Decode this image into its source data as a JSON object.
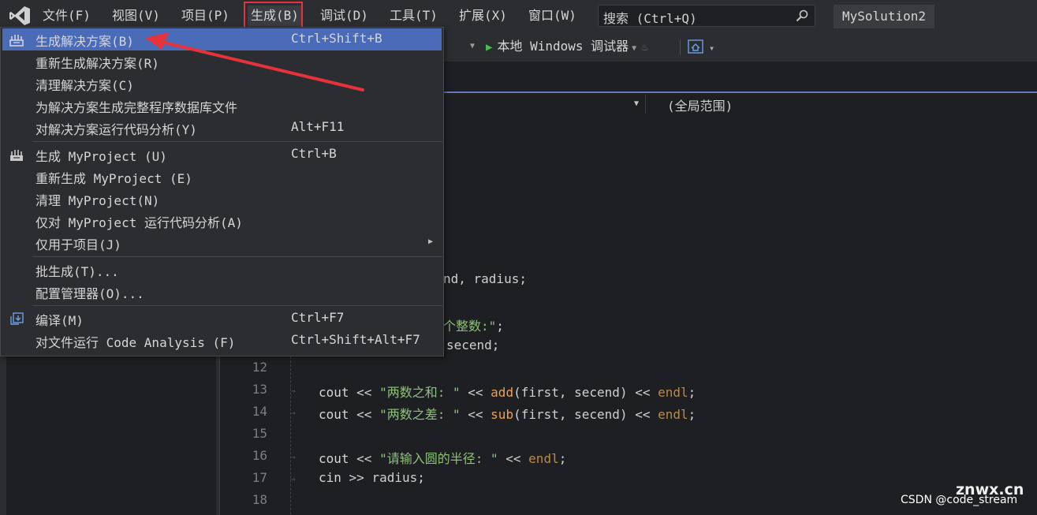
{
  "menubar": {
    "items": [
      {
        "label": "文件(F)"
      },
      {
        "label": "视图(V)"
      },
      {
        "label": "项目(P)"
      },
      {
        "label": "生成(B)"
      },
      {
        "label": "调试(D)"
      },
      {
        "label": "工具(T)"
      },
      {
        "label": "扩展(X)"
      },
      {
        "label": "窗口(W)"
      }
    ],
    "search_placeholder": "搜索 (Ctrl+Q)",
    "solution_name": "MySolution2"
  },
  "toolbar": {
    "run_label": "本地 Windows 调试器"
  },
  "navbar": {
    "scope": "(全局范围)"
  },
  "build_menu": {
    "items": [
      {
        "label": "生成解决方案(B)",
        "shortcut": "Ctrl+Shift+B"
      },
      {
        "label": "重新生成解决方案(R)",
        "shortcut": ""
      },
      {
        "label": "清理解决方案(C)",
        "shortcut": ""
      },
      {
        "label": "为解决方案生成完整程序数据库文件",
        "shortcut": ""
      },
      {
        "label": "对解决方案运行代码分析(Y)",
        "shortcut": "Alt+F11"
      },
      {
        "label": "生成 MyProject (U)",
        "shortcut": "Ctrl+B"
      },
      {
        "label": "重新生成 MyProject (E)",
        "shortcut": ""
      },
      {
        "label": "清理 MyProject(N)",
        "shortcut": ""
      },
      {
        "label": "仅对 MyProject 运行代码分析(A)",
        "shortcut": ""
      },
      {
        "label": "仅用于项目(J)",
        "shortcut": ""
      },
      {
        "label": "批生成(T)...",
        "shortcut": ""
      },
      {
        "label": "配置管理器(O)...",
        "shortcut": ""
      },
      {
        "label": "编译(M)",
        "shortcut": "Ctrl+F7"
      },
      {
        "label": "对文件运行 Code Analysis (F)",
        "shortcut": "Ctrl+Shift+Alt+F7"
      }
    ]
  },
  "editor": {
    "partial_lines": {
      "l9": "nd, radius;",
      "l10_str": "个整数:\"",
      "l10_end": ";",
      "l11": "secend;"
    },
    "line_numbers": [
      "12",
      "13",
      "14",
      "15",
      "16",
      "17",
      "18"
    ],
    "lines": {
      "l13": {
        "a": "cout",
        "b": "<<",
        "c": "\"两数之和: \"",
        "d": "<<",
        "e": "add",
        "f": "(first, secend)",
        "g": "<<",
        "h": "endl",
        "i": ";"
      },
      "l14": {
        "a": "cout",
        "b": "<<",
        "c": "\"两数之差: \"",
        "d": "<<",
        "e": "sub",
        "f": "(first, secend)",
        "g": "<<",
        "h": "endl",
        "i": ";"
      },
      "l16": {
        "a": "cout",
        "b": "<<",
        "c": "\"请输入圆的半径: \"",
        "d": "<<",
        "h": "endl",
        "i": ";"
      },
      "l17": {
        "a": "cin",
        "b": ">>",
        "f": "radius;"
      }
    }
  },
  "watermark": {
    "site": "znwx.cn",
    "author": "CSDN @code_stream"
  },
  "colors": {
    "menu_highlight": "#4a6bb8",
    "annotation_red": "#e5323b",
    "play_green": "#45c14a",
    "string_green": "#8ec07c",
    "function_orange": "#f0a050"
  }
}
